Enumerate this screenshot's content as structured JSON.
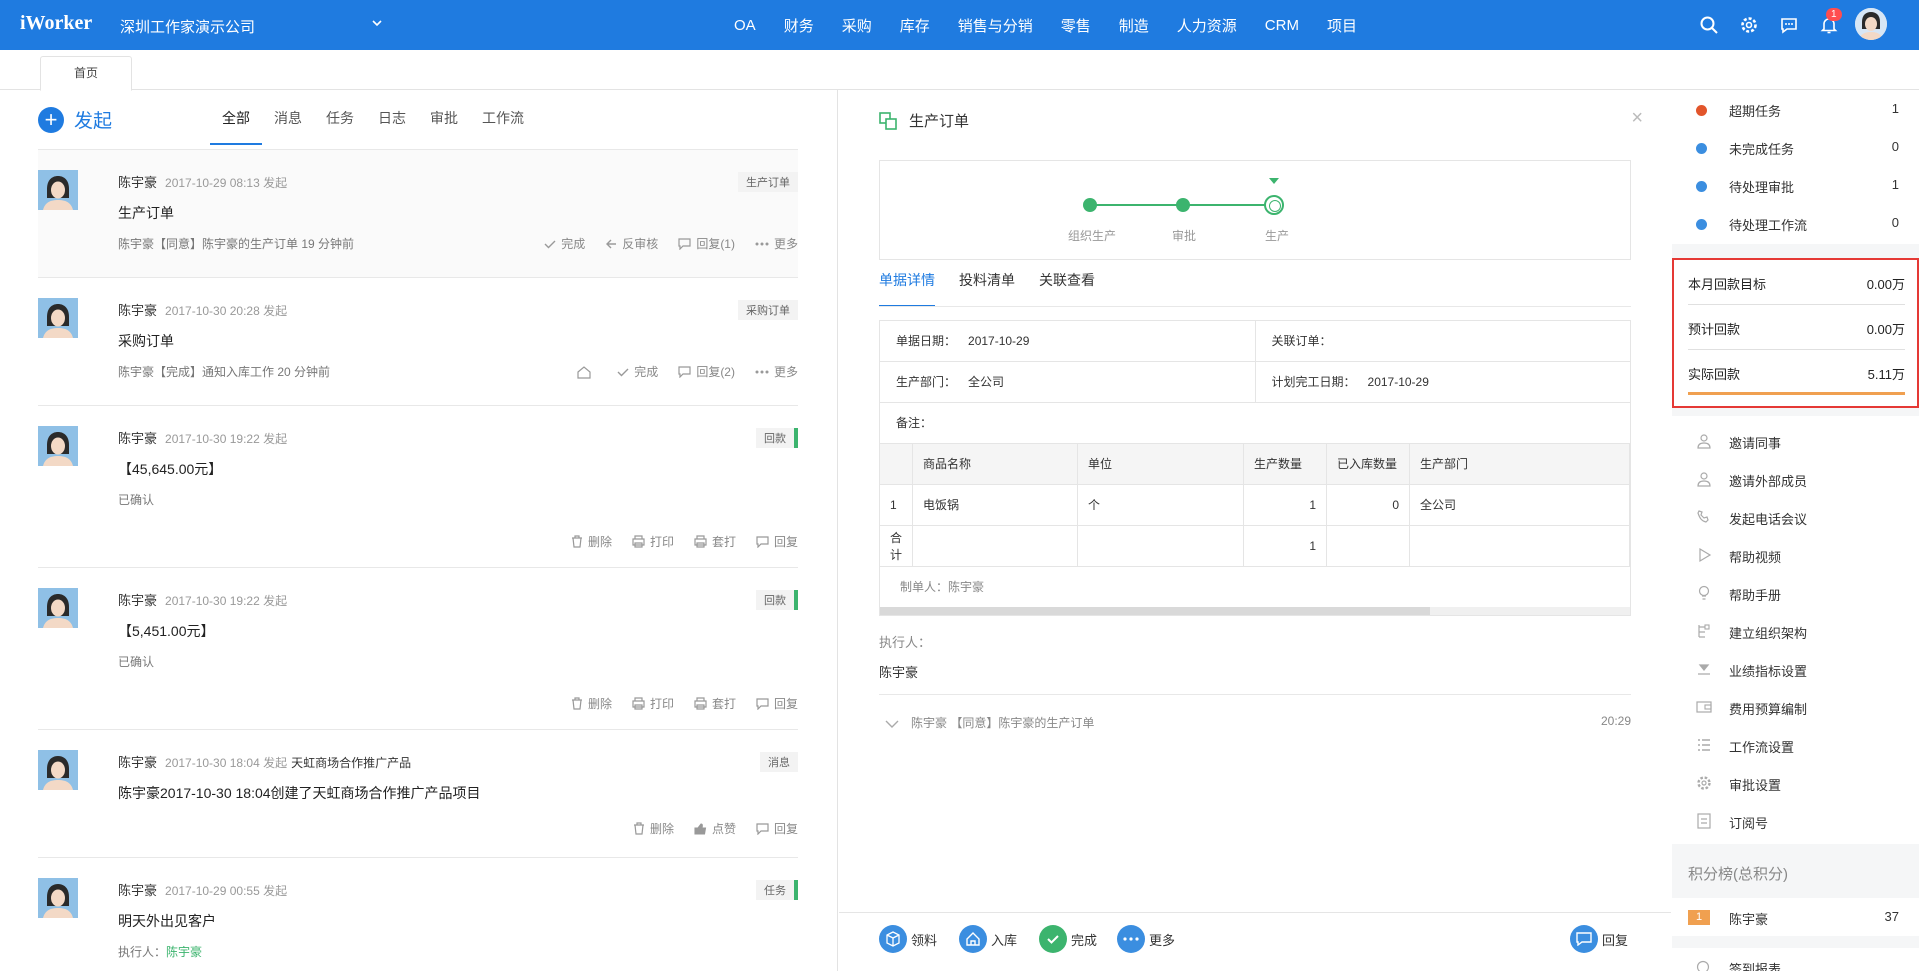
{
  "app": {
    "logo": "iWorker",
    "company": "深圳工作家演示公司"
  },
  "topnav": [
    "OA",
    "财务",
    "采购",
    "库存",
    "销售与分销",
    "零售",
    "制造",
    "人力资源",
    "CRM",
    "项目"
  ],
  "notify_badge": "1",
  "tab_home": "首页",
  "feed": {
    "new_label": "发起",
    "tabs": [
      "全部",
      "消息",
      "任务",
      "日志",
      "审批",
      "工作流"
    ],
    "items": [
      {
        "name": "陈宇豪",
        "time": "2017-10-29 08:13 发起",
        "tag": "生产订单",
        "title": "生产订单",
        "note": "陈宇豪【同意】陈宇豪的生产订单   19 分钟前",
        "actions": [
          "完成",
          "反审核",
          "回复(1)",
          "更多"
        ]
      },
      {
        "name": "陈宇豪",
        "time": "2017-10-30 20:28 发起",
        "tag": "采购订单",
        "title": "采购订单",
        "note": "陈宇豪【完成】通知入库工作   20 分钟前",
        "actions": [
          "完成",
          "回复(2)",
          "更多"
        ]
      },
      {
        "name": "陈宇豪",
        "time": "2017-10-30 19:22 发起",
        "tag": "回款",
        "title": "【45,645.00元】",
        "note": "已确认",
        "actions": [
          "删除",
          "打印",
          "套打",
          "回复"
        ]
      },
      {
        "name": "陈宇豪",
        "time": "2017-10-30 19:22 发起",
        "tag": "回款",
        "title": "【5,451.00元】",
        "note": "已确认",
        "actions": [
          "删除",
          "打印",
          "套打",
          "回复"
        ]
      },
      {
        "name": "陈宇豪",
        "time": "2017-10-30 18:04 发起",
        "subject": "天虹商场合作推广产品",
        "tag": "消息",
        "title": "陈宇豪2017-10-30 18:04创建了天虹商场合作推广产品项目",
        "actions": [
          "删除",
          "点赞",
          "回复"
        ]
      },
      {
        "name": "陈宇豪",
        "time": "2017-10-29 00:55 发起",
        "tag": "任务",
        "title": "明天外出见客户",
        "exec_label": "执行人：",
        "exec_name": "陈宇豪"
      }
    ]
  },
  "doc": {
    "title": "生产订单",
    "steps": [
      "组织生产",
      "审批",
      "生产"
    ],
    "tabs": [
      "单据详情",
      "投料清单",
      "关联查看"
    ],
    "fields": {
      "date_label": "单据日期：",
      "date": "2017-10-29",
      "rel_label": "关联订单：",
      "rel": "",
      "dept_label": "生产部门：",
      "dept": "全公司",
      "plan_label": "计划完工日期：",
      "plan": "2017-10-29",
      "remark_label": "备注："
    },
    "table": {
      "headers": [
        "",
        "商品名称",
        "单位",
        "生产数量",
        "已入库数量",
        "生产部门"
      ],
      "rows": [
        [
          "1",
          "电饭锅",
          "个",
          "1",
          "0",
          "全公司"
        ]
      ],
      "total": [
        "合计",
        "",
        "",
        "1",
        "",
        ""
      ]
    },
    "maker": "制单人：陈宇豪",
    "exec_label": "执行人：",
    "exec_name": "陈宇豪",
    "log_text": "陈宇豪  【同意】陈宇豪的生产订单",
    "log_time": "20:29",
    "bottom_actions": [
      "领料",
      "入库",
      "完成",
      "更多"
    ],
    "reply": "回复"
  },
  "right": {
    "stats": [
      {
        "label": "超期任务",
        "count": "1",
        "color": "#e2552b"
      },
      {
        "label": "未完成任务",
        "count": "0",
        "color": "#3b8ee0"
      },
      {
        "label": "待处理审批",
        "count": "1",
        "color": "#3b8ee0"
      },
      {
        "label": "待处理工作流",
        "count": "0",
        "color": "#3b8ee0"
      }
    ],
    "payments": [
      {
        "label": "本月回款目标",
        "value": "0.00万"
      },
      {
        "label": "预计回款",
        "value": "0.00万"
      },
      {
        "label": "实际回款",
        "value": "5.11万"
      }
    ],
    "menu": [
      "邀请同事",
      "邀请外部成员",
      "发起电话会议",
      "帮助视频",
      "帮助手册",
      "建立组织架构",
      "业绩指标设置",
      "费用预算编制",
      "工作流设置",
      "审批设置",
      "订阅号"
    ],
    "rank_title": "积分榜(总积分)",
    "rank": {
      "pos": "1",
      "name": "陈宇豪",
      "score": "37"
    },
    "sign": "签到报表"
  }
}
